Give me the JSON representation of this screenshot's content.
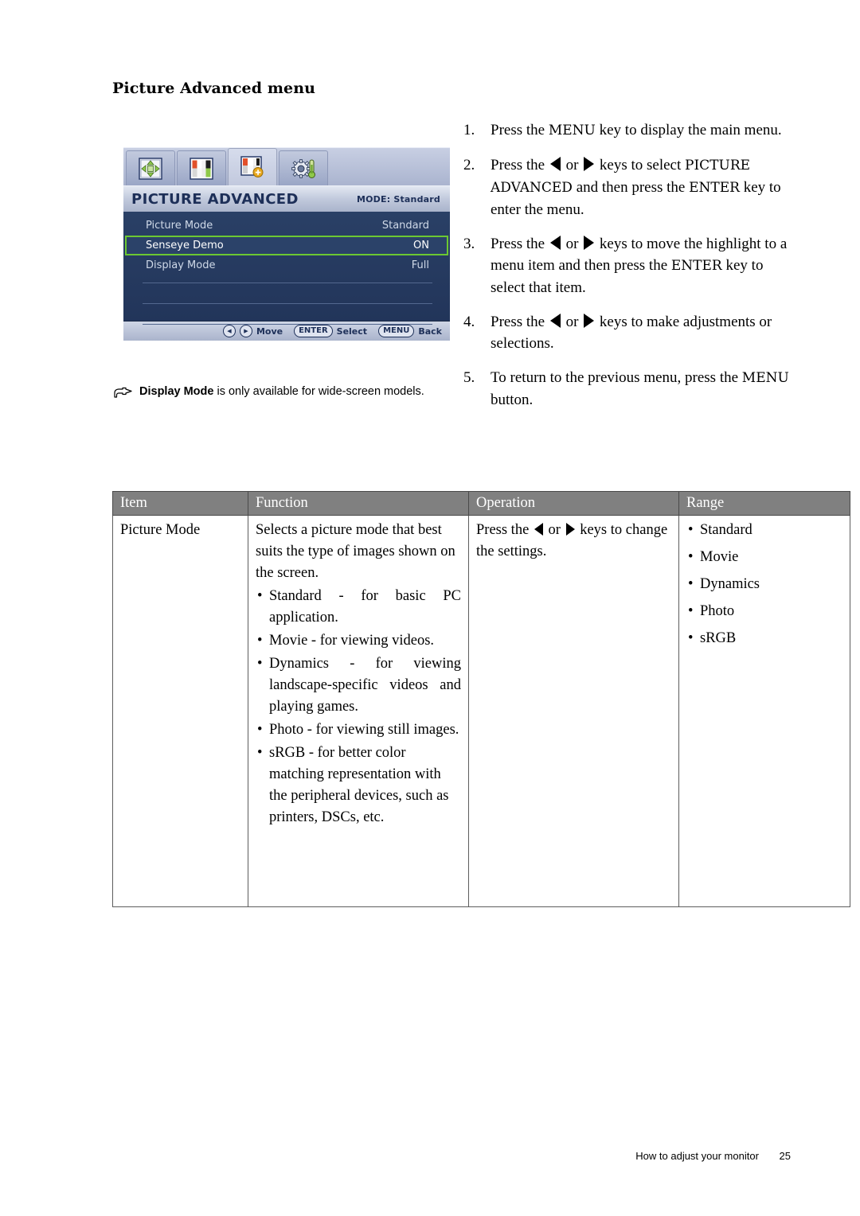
{
  "page": {
    "heading": "Picture Advanced menu",
    "footer_text": "How to adjust your monitor",
    "footer_page": "25"
  },
  "osd": {
    "tabs": [
      {
        "name": "display-tab",
        "icon": "four-arrows-icon",
        "active": false
      },
      {
        "name": "picture-tab",
        "icon": "color-bars-icon",
        "active": false
      },
      {
        "name": "picture-advanced-tab",
        "icon": "color-bars-plus-icon",
        "active": true
      },
      {
        "name": "system-tab",
        "icon": "gear-thermometer-icon",
        "active": false
      }
    ],
    "title": "PICTURE ADVANCED",
    "mode_label": "MODE: Standard",
    "rows": [
      {
        "label": "Picture Mode",
        "value": "Standard",
        "selected": false
      },
      {
        "label": "Senseye Demo",
        "value": "ON",
        "selected": true
      },
      {
        "label": "Display Mode",
        "value": "Full",
        "selected": false
      }
    ],
    "footer": {
      "move_label": "Move",
      "enter_key": "ENTER",
      "select_label": "Select",
      "menu_key": "MENU",
      "back_label": "Back"
    },
    "highlight_color": "#6cc832",
    "body_color": "#253a5e"
  },
  "note": {
    "icon": "pointing-hand-icon",
    "bold_text": "Display Mode",
    "rest_text": " is only available for wide-screen models."
  },
  "steps": [
    {
      "num": "1.",
      "seg1": "Press the ",
      "bold1": "MENU",
      "seg2": " key to display the main menu.",
      "arrows": false
    },
    {
      "num": "2.",
      "seg1": "Press the ",
      "seg2": " or ",
      "seg3": " keys to select ",
      "bold1": "PICTURE ADVANCED",
      "seg4": " and then press the ",
      "bold2": "ENTER",
      "seg5": " key to enter the menu.",
      "arrows": true
    },
    {
      "num": "3.",
      "seg1": "Press the ",
      "seg2": " or ",
      "seg3": " keys to move the highlight to a menu item and then press the ",
      "bold1": "ENTER",
      "seg4": " key to select that item.",
      "arrows": true
    },
    {
      "num": "4.",
      "seg1": "Press the ",
      "seg2": " or ",
      "seg3": " keys to make adjustments or selections.",
      "arrows": true
    },
    {
      "num": "5.",
      "seg1": "To return to the previous menu, press the ",
      "bold1": "MENU",
      "seg2": " button.",
      "arrows": false
    }
  ],
  "table": {
    "headers": [
      "Item",
      "Function",
      "Operation",
      "Range"
    ],
    "row": {
      "item": "Picture Mode",
      "function_intro": "Selects a picture mode that best suits the type of images shown on the screen.",
      "function_bullets": [
        "Standard - for basic PC application.",
        "Movie - for viewing videos.",
        "Dynamics - for viewing landscape-specific videos and playing games.",
        "Photo - for viewing still images.",
        "sRGB - for better color matching representation with the peripheral devices, such as printers, DSCs, etc."
      ],
      "operation_pre": "Press the ",
      "operation_mid": " or ",
      "operation_post": " keys to change the settings.",
      "range": [
        "Standard",
        "Movie",
        "Dynamics",
        "Photo",
        "sRGB"
      ]
    }
  }
}
